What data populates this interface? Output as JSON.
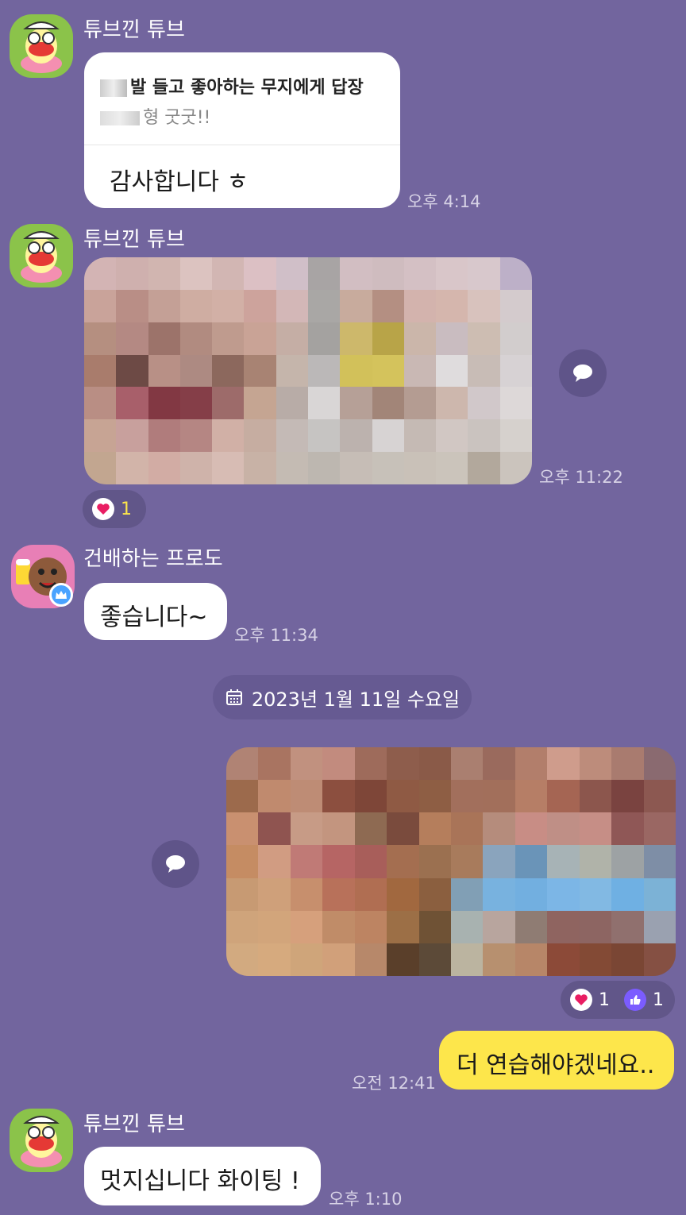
{
  "messages": {
    "m1": {
      "sender": "튜브낀 튜브",
      "reply_title": "발 들고 좋아하는 무지에게 답장",
      "reply_quote": "형 굿굿!!",
      "text": "감사합니다 ㅎ",
      "time": "오후 4:14"
    },
    "m2": {
      "sender": "튜브낀 튜브",
      "time": "오후 11:22",
      "reaction_heart": "1"
    },
    "m3": {
      "sender": "건배하는 프로도",
      "text": "좋습니다~",
      "time": "오후 11:34"
    },
    "date_divider": "2023년 1월 11일 수요일",
    "m4": {
      "reaction_heart": "1",
      "reaction_like": "1"
    },
    "m5": {
      "text": "더 연습해야겠네요..",
      "time": "오전 12:41"
    },
    "m6": {
      "sender": "튜브낀 튜브",
      "text": "멋지십니다 화이팅 !",
      "time": "오후 1:10"
    }
  },
  "colors": {
    "background": "#72659e",
    "my_bubble": "#fde64b",
    "other_bubble": "#ffffff",
    "heart": "#e91e63",
    "like": "#7b5cff"
  },
  "icons": [
    "share-icon",
    "heart-icon",
    "thumbs-up-icon",
    "calendar-icon",
    "crown-badge-icon"
  ]
}
